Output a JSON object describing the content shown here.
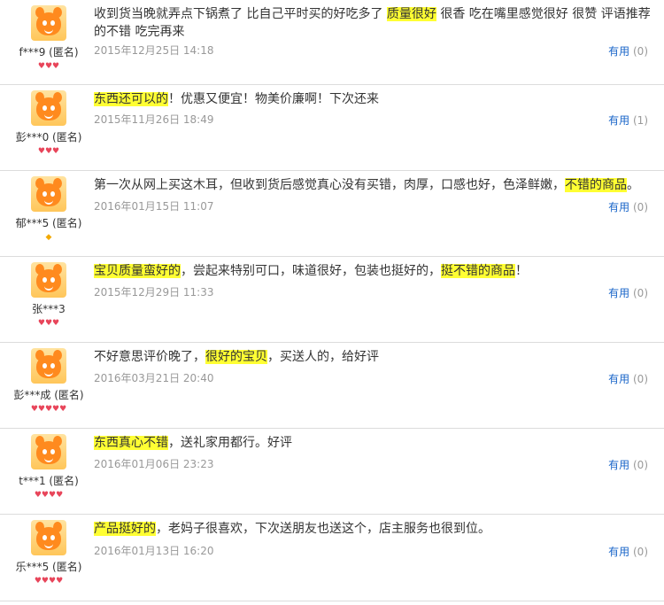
{
  "reviews": [
    {
      "user": "f***9 (匿名)",
      "badge": "♥♥♥",
      "badge_type": "heart",
      "text": [
        {
          "t": "收到货当晚就弄点下锅煮了 比自己平时买的好吃多了 ",
          "h": false
        },
        {
          "t": "质量很好",
          "h": true
        },
        {
          "t": " 很香 吃在嘴里感觉很好 很赞 评语推荐的不错 吃完再来",
          "h": false
        }
      ],
      "date": "2015年12月25日 14:18",
      "useful_label": "有用",
      "useful_count": "(0)"
    },
    {
      "user": "彭***0 (匿名)",
      "badge": "♥♥♥",
      "badge_type": "heart",
      "text": [
        {
          "t": "东西还可以的",
          "h": true
        },
        {
          "t": "！优惠又便宜！物美价廉啊！下次还来",
          "h": false
        }
      ],
      "date": "2015年11月26日 18:49",
      "useful_label": "有用",
      "useful_count": "(1)"
    },
    {
      "user": "郁***5 (匿名)",
      "badge": "◆",
      "badge_type": "diamond",
      "text": [
        {
          "t": "第一次从网上买这木耳，但收到货后感觉真心没有买错，肉厚，口感也好，色泽鲜嫩，",
          "h": false
        },
        {
          "t": "不错的商品",
          "h": true
        },
        {
          "t": "。",
          "h": false
        }
      ],
      "date": "2016年01月15日 11:07",
      "useful_label": "有用",
      "useful_count": "(0)"
    },
    {
      "user": "张***3",
      "badge": "♥♥♥",
      "badge_type": "heart",
      "text": [
        {
          "t": "宝贝质量蛮好的",
          "h": true
        },
        {
          "t": "，尝起来特别可口，味道很好，包装也挺好的，",
          "h": false
        },
        {
          "t": "挺不错的商品",
          "h": true
        },
        {
          "t": "！",
          "h": false
        }
      ],
      "date": "2015年12月29日 11:33",
      "useful_label": "有用",
      "useful_count": "(0)"
    },
    {
      "user": "彭***成 (匿名)",
      "badge": "♥♥♥♥♥",
      "badge_type": "heart",
      "text": [
        {
          "t": "不好意思评价晚了，",
          "h": false
        },
        {
          "t": "很好的宝贝",
          "h": true
        },
        {
          "t": "，买送人的，给好评",
          "h": false
        }
      ],
      "date": "2016年03月21日 20:40",
      "useful_label": "有用",
      "useful_count": "(0)"
    },
    {
      "user": "t***1 (匿名)",
      "badge": "♥♥♥♥",
      "badge_type": "heart",
      "text": [
        {
          "t": "东西真心不错",
          "h": true
        },
        {
          "t": "，送礼家用都行。好评",
          "h": false
        }
      ],
      "date": "2016年01月06日 23:23",
      "useful_label": "有用",
      "useful_count": "(0)"
    },
    {
      "user": "乐***5 (匿名)",
      "badge": "♥♥♥♥",
      "badge_type": "heart",
      "text": [
        {
          "t": "产品挺好的",
          "h": true
        },
        {
          "t": "，老妈子很喜欢，下次送朋友也送这个，店主服务也很到位。",
          "h": false
        }
      ],
      "date": "2016年01月13日 16:20",
      "useful_label": "有用",
      "useful_count": "(0)"
    }
  ]
}
